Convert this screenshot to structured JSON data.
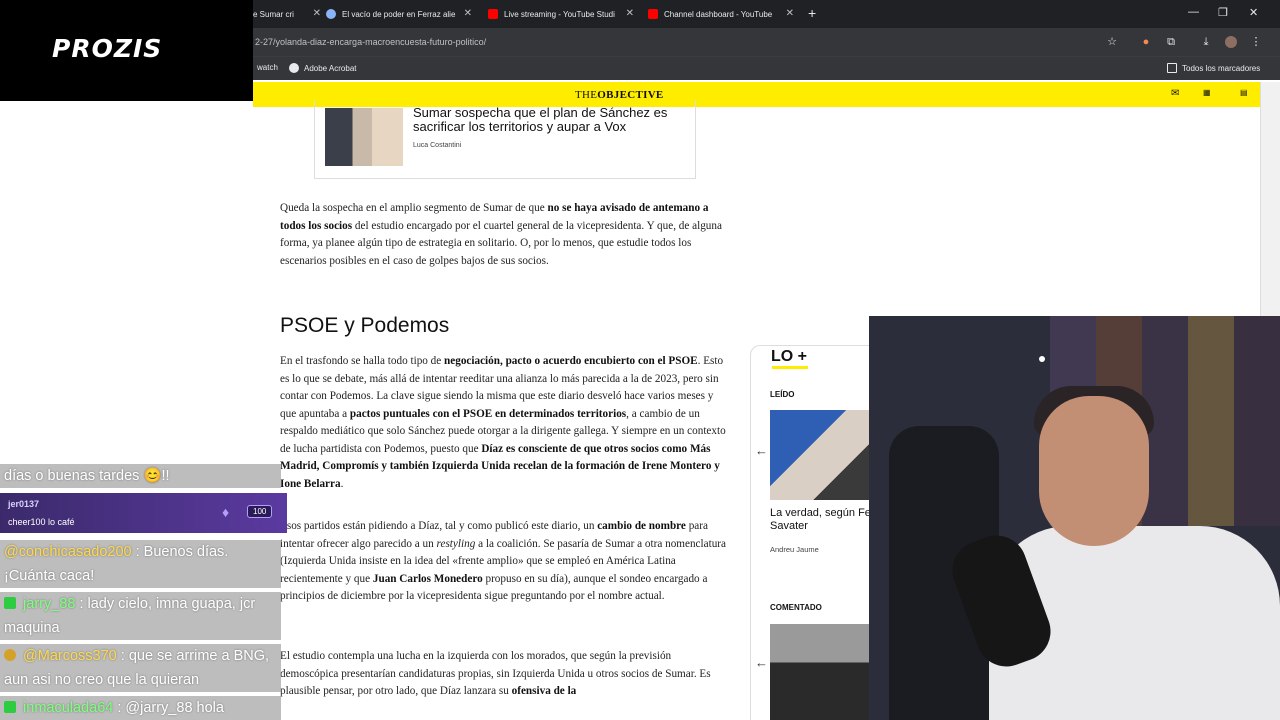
{
  "browser": {
    "tabs": [
      {
        "title": "e Sumar cri",
        "icon_color": "#9aa0a6"
      },
      {
        "title": "El vacío de poder en Ferraz alie",
        "icon_color": "#8ab4f8"
      },
      {
        "title": "Live streaming - YouTube Studi",
        "icon_color": "#ff0000"
      },
      {
        "title": "Channel dashboard - YouTube",
        "icon_color": "#ff0000"
      }
    ],
    "close_glyph": "✕",
    "new_tab_glyph": "+",
    "window_controls": [
      "—",
      "❐",
      "✕"
    ],
    "url": "2-27/yolanda-diaz-encarga-macroencuesta-futuro-politico/",
    "bookmarks": [
      {
        "label": "watch",
        "icon": "none"
      },
      {
        "label": "Adobe Acrobat",
        "icon": "acrobat-icon"
      }
    ],
    "all_bookmarks": "Todos los marcadores"
  },
  "site": {
    "logo_prefix": "THE",
    "logo_bold": "OBJECTIVE",
    "header_icons": [
      "mail-icon",
      "tobo-icon",
      "my-to-icon"
    ]
  },
  "article": {
    "related_title": "Sumar sospecha que el plan de Sánchez es sacrificar los territorios y aupar a Vox",
    "related_author": "Luca Costantini",
    "p1": [
      {
        "t": "Queda la sospecha en el amplio segmento de Sumar de que "
      },
      {
        "t": "no se haya avisado de antemano a todos los socios",
        "b": true
      },
      {
        "t": " del estudio encargado por el cuartel general de la vicepresidenta. Y que, de alguna forma, ya planee algún tipo de estrategia en solitario. O, por lo menos, que estudie todos los escenarios posibles en el caso de golpes bajos de sus socios."
      }
    ],
    "h2": "PSOE y Podemos",
    "p2": [
      {
        "t": "En el trasfondo se halla todo tipo de "
      },
      {
        "t": "negociación, pacto o acuerdo encubierto con el PSOE",
        "b": true
      },
      {
        "t": ". Esto es lo que se debate, más allá de intentar reeditar una alianza lo más parecida a la de 2023, pero sin contar con Podemos. La clave sigue siendo la misma que este diario desveló hace varios meses y que apuntaba a "
      },
      {
        "t": "pactos puntuales con el PSOE en determinados territorios",
        "b": true
      },
      {
        "t": ", a cambio de un respaldo mediático que solo Sánchez puede otorgar a la dirigente gallega. Y siempre en un contexto de lucha partidista con Podemos, puesto que "
      },
      {
        "t": "Díaz es consciente de que otros socios como Más Madrid, Compromís y también Izquierda Unida recelan de la formación de Irene Montero y Ione Belarra",
        "b": true
      },
      {
        "t": "."
      }
    ],
    "p3": [
      {
        "t": "Esos partidos están pidiendo a Díaz, tal y como publicó este diario, un "
      },
      {
        "t": "cambio de nombre",
        "b": true
      },
      {
        "t": " para intentar ofrecer algo parecido a un "
      },
      {
        "t": "restyling",
        "i": true
      },
      {
        "t": " a la coalición. Se pasaría de Sumar a otra nomenclatura (Izquierda Unida insiste en la idea del «frente amplio» que se empleó en América Latina recientemente y que "
      },
      {
        "t": "Juan Carlos Monedero",
        "b": true
      },
      {
        "t": " propuso en su día), aunque el sondeo encargado a principios de diciembre por la vicepresidenta sigue preguntando por el nombre actual."
      }
    ],
    "p4": [
      {
        "t": "El estudio contempla una lucha en la izquierda con los morados, que según la previsión demoscópica presentarían candidaturas propias, sin Izquierda Unida u otros socios de Sumar. Es plausible pensar, por otro lado, que Díaz lanzara su "
      },
      {
        "t": "ofensiva de la",
        "b": true
      }
    ]
  },
  "widget": {
    "title": "LO +",
    "section1": "LEÍDO",
    "item1_title": "La verdad, según Fe",
    "item1_title_line2": "Savater",
    "item1_author": "Andreu Jaume",
    "section2": "COMENTADO",
    "arrow": "←"
  },
  "overlay": {
    "brand": "PROZIS",
    "chat": [
      {
        "user": "",
        "text": "días o buenas tardes 😊!!",
        "user_color": "#ffd84a"
      },
      {
        "user": "@conchicasado200",
        "text": ": Buenos días. ¡Cuánta caca!",
        "user_color": "#ffd84a"
      },
      {
        "user": "jarry_88",
        "text": ": lady cielo, imna guapa, jcr maquina",
        "user_color": "#7dff7d"
      },
      {
        "user": "@Marcoss370",
        "text": ": que se arrime a BNG, aun asi no creo que la quieran",
        "user_color": "#ffd84a"
      },
      {
        "user": "inmaculada64",
        "text": ": @jarry_88 hola",
        "user_color": "#7dff7d"
      }
    ],
    "cheer": {
      "user": "jer0137",
      "text": "cheer100 lo café",
      "amount": "100"
    }
  }
}
